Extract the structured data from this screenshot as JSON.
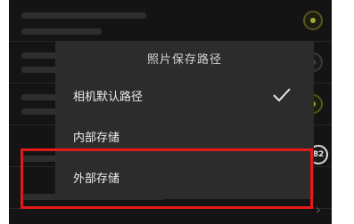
{
  "dialog": {
    "title": "照片保存路径",
    "options": [
      {
        "label": "相机默认路径",
        "selected": true
      },
      {
        "label": "内部存储",
        "selected": false
      },
      {
        "label": "外部存储",
        "selected": false
      }
    ]
  },
  "background": {
    "fps_badge": "82"
  },
  "colors": {
    "highlight": "#e41919",
    "dialog_bg": "#2c2c2c",
    "toggle_accent": "#a7a734"
  }
}
